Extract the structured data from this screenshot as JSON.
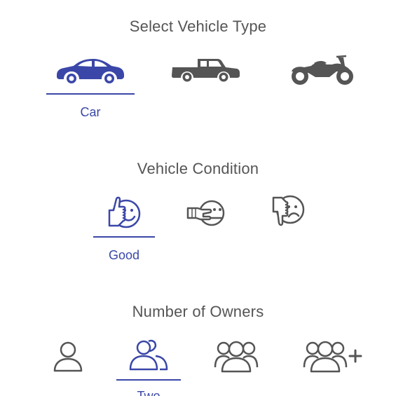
{
  "vehicle_type": {
    "title": "Select Vehicle Type",
    "options": [
      {
        "id": "car",
        "icon": "car-icon",
        "selected": true,
        "label": "Car"
      },
      {
        "id": "truck",
        "icon": "pickup-truck-icon",
        "selected": false
      },
      {
        "id": "motorcycle",
        "icon": "motorcycle-icon",
        "selected": false
      }
    ]
  },
  "condition": {
    "title": "Vehicle Condition",
    "options": [
      {
        "id": "good",
        "icon": "thumbs-up-face-icon",
        "selected": true,
        "label": "Good"
      },
      {
        "id": "average",
        "icon": "sideways-thumb-face-icon",
        "selected": false
      },
      {
        "id": "poor",
        "icon": "thumbs-down-face-icon",
        "selected": false
      }
    ]
  },
  "owners": {
    "title": "Number of Owners",
    "options": [
      {
        "id": "one",
        "icon": "single-person-icon",
        "selected": false
      },
      {
        "id": "two",
        "icon": "two-people-icon",
        "selected": true,
        "label": "Two"
      },
      {
        "id": "three",
        "icon": "three-people-icon",
        "selected": false
      },
      {
        "id": "four-plus",
        "icon": "group-plus-icon",
        "selected": false
      }
    ]
  },
  "colors": {
    "selected": "#3a47a8",
    "unselected": "#555555",
    "title": "#555555",
    "background": "#ffffff"
  }
}
